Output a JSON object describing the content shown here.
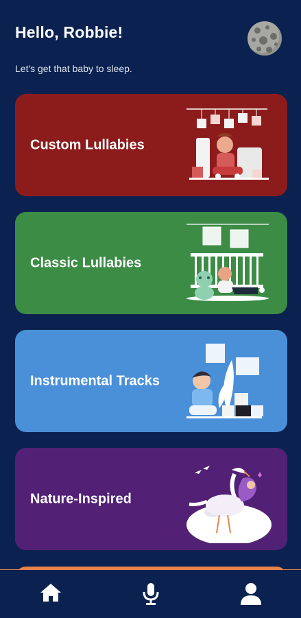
{
  "header": {
    "greeting": "Hello, Robbie!",
    "subtitle": "Let's get that baby to sleep."
  },
  "avatar": {
    "icon": "moon-avatar-icon"
  },
  "cards": [
    {
      "label": "Custom Lullabies",
      "color": "#8c1c1c",
      "illustration": "toy-room-illustration"
    },
    {
      "label": "Classic Lullabies",
      "color": "#3c8c46",
      "illustration": "crib-baby-illustration"
    },
    {
      "label": "Instrumental Tracks",
      "color": "#4a90d9",
      "illustration": "baby-blocks-illustration"
    },
    {
      "label": "Nature-Inspired",
      "color": "#522175",
      "illustration": "stork-baby-illustration"
    }
  ],
  "tabbar": {
    "items": [
      {
        "icon": "home-icon"
      },
      {
        "icon": "microphone-icon"
      },
      {
        "icon": "profile-icon"
      }
    ],
    "accent": "#e8834a"
  }
}
